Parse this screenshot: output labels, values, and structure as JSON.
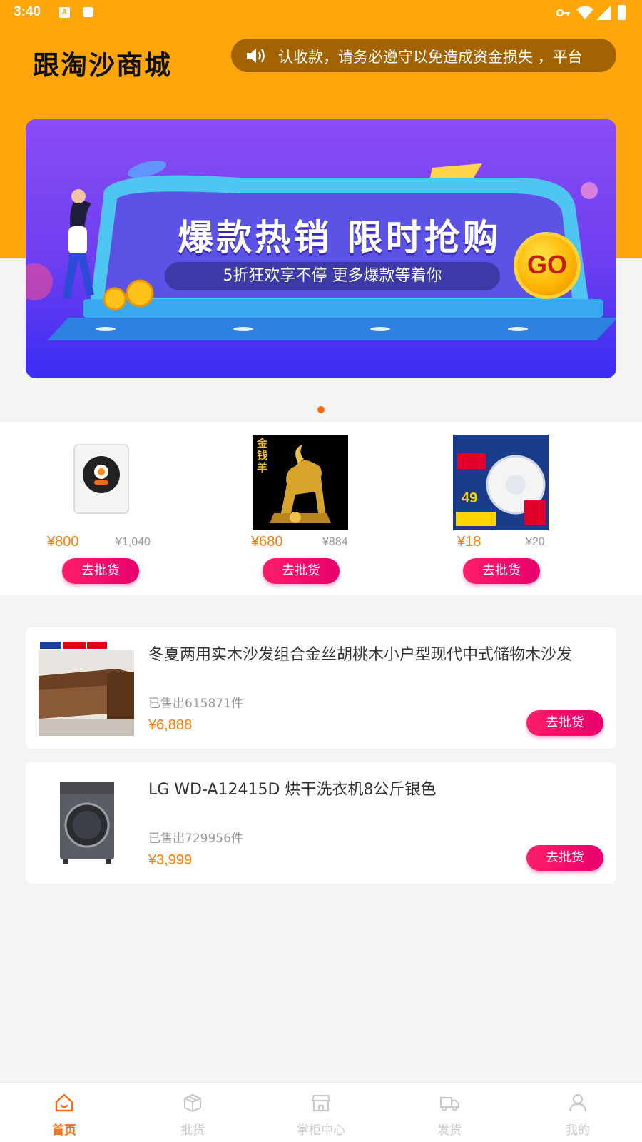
{
  "status_bar": {
    "time": "3:40",
    "a_icon_letter": "A"
  },
  "header": {
    "logo_text": "跟淘沙商城",
    "notice_text": "认收款，请务必遵守以免造成资金损失 ，平台"
  },
  "banner": {
    "title": "爆款热销 限时抢购",
    "subtitle": "5折狂欢享不停 更多爆款等着你",
    "go_label": "GO"
  },
  "featured": [
    {
      "price": "¥800",
      "original_price": "¥1,040",
      "button_label": "去批货",
      "image_icon": "water-heater-icon"
    },
    {
      "price": "¥680",
      "original_price": "¥884",
      "button_label": "去批货",
      "image_icon": "gold-goat-icon",
      "image_text": "金钱羊"
    },
    {
      "price": "¥18",
      "original_price": "¥20",
      "button_label": "去批货",
      "image_icon": "smoke-detector-icon",
      "image_text": "49"
    }
  ],
  "products": [
    {
      "title": "冬夏两用实木沙发组合金丝胡桃木小户型现代中式储物木沙发",
      "sold": "已售出615871件",
      "price": "¥6,888",
      "button_label": "去批货",
      "image_icon": "sofa-icon"
    },
    {
      "title": "LG WD-A12415D 烘干洗衣机8公斤银色",
      "sold": "已售出729956件",
      "price": "¥3,999",
      "button_label": "去批货",
      "image_icon": "washing-machine-icon"
    }
  ],
  "tabbar": [
    {
      "label": "首页",
      "icon": "home-icon",
      "active": true
    },
    {
      "label": "批货",
      "icon": "box-icon",
      "active": false
    },
    {
      "label": "掌柜中心",
      "icon": "store-icon",
      "active": false
    },
    {
      "label": "发货",
      "icon": "truck-icon",
      "active": false
    },
    {
      "label": "我的",
      "icon": "user-icon",
      "active": false
    }
  ],
  "colors": {
    "header": "#ffa60c",
    "notice_bg": "#a26300",
    "price": "#ff7a00",
    "button": "#e6006d",
    "active_tab": "#ff6a13"
  }
}
